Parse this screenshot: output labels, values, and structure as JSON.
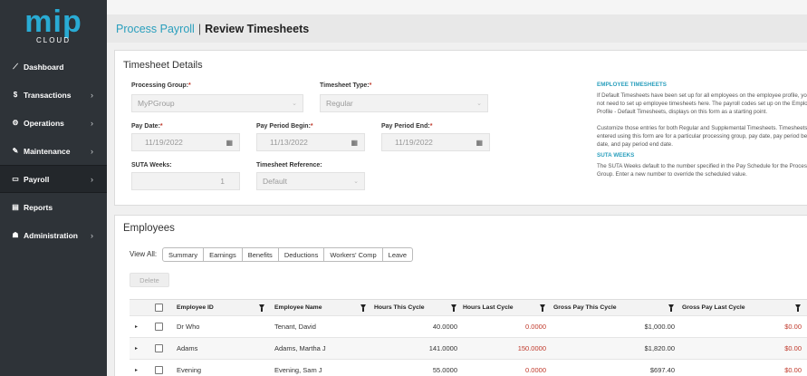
{
  "logo": {
    "brand": "mip",
    "sub": "CLOUD"
  },
  "sidebar": {
    "items": [
      {
        "label": "Dashboard",
        "icon": "chart-icon",
        "glyph": "⟋",
        "chevron": false,
        "active": false
      },
      {
        "label": "Transactions",
        "icon": "dollar-icon",
        "glyph": "$",
        "chevron": true,
        "active": false
      },
      {
        "label": "Operations",
        "icon": "cogs-icon",
        "glyph": "⚙",
        "chevron": true,
        "active": false
      },
      {
        "label": "Maintenance",
        "icon": "wrench-icon",
        "glyph": "✎",
        "chevron": true,
        "active": false
      },
      {
        "label": "Payroll",
        "icon": "money-icon",
        "glyph": "▭",
        "chevron": true,
        "active": true
      },
      {
        "label": "Reports",
        "icon": "file-icon",
        "glyph": "▤",
        "chevron": false,
        "active": false
      },
      {
        "label": "Administration",
        "icon": "users-icon",
        "glyph": "☗",
        "chevron": true,
        "active": false
      }
    ],
    "chevron_glyph": "›"
  },
  "header": {
    "crumb": "Process Payroll",
    "separator": "|",
    "current": "Review Timesheets"
  },
  "details": {
    "title": "Timesheet Details",
    "processing_group": {
      "label": "Processing Group:",
      "required": "*",
      "value": "MyPGroup"
    },
    "timesheet_type": {
      "label": "Timesheet Type:",
      "required": "*",
      "value": "Regular"
    },
    "pay_date": {
      "label": "Pay Date:",
      "required": "*",
      "value": "11/19/2022"
    },
    "period_begin": {
      "label": "Pay Period Begin:",
      "required": "*",
      "value": "11/13/2022"
    },
    "period_end": {
      "label": "Pay Period End:",
      "required": "*",
      "value": "11/19/2022"
    },
    "suta_weeks": {
      "label": "SUTA Weeks:",
      "value": "1"
    },
    "timesheet_ref": {
      "label": "Timesheet Reference:",
      "value": "Default"
    },
    "help": {
      "emp_title": "EMPLOYEE TIMESHEETS",
      "emp_p1": "If Default Timesheets have been set up for all employees on the employee profile, you do not need to set up employee timesheets here. The payroll codes set up on the Employee Profile - Default Timesheets, displays on this form as a starting point.",
      "emp_p2": "Customize those entries for both Regular and Supplemental Timesheets. Timesheets entered using this form are for a particular processing group, pay date, pay period begin date, and pay period end date.",
      "suta_title": "SUTA WEEKS",
      "suta_p": "The SUTA Weeks default to the number specified in the Pay Schedule for the Processing Group. Enter a new number to override the scheduled value."
    }
  },
  "employees": {
    "title": "Employees",
    "view_all_label": "View All:",
    "tabs": [
      "Summary",
      "Earnings",
      "Benefits",
      "Deductions",
      "Workers' Comp",
      "Leave"
    ],
    "delete_label": "Delete",
    "columns": {
      "employee_id": "Employee ID",
      "employee_name": "Employee Name",
      "hours_this": "Hours This Cycle",
      "hours_last": "Hours Last Cycle",
      "gross_this": "Gross Pay This Cycle",
      "gross_last": "Gross Pay Last Cycle"
    },
    "rows": [
      {
        "id": "Dr Who",
        "name": "Tenant, David",
        "hours_this": "40.0000",
        "hours_last": "0.0000",
        "gross_this": "$1,000.00",
        "gross_last": "$0.00"
      },
      {
        "id": "Adams",
        "name": "Adams, Martha J",
        "hours_this": "141.0000",
        "hours_last": "150.0000",
        "gross_this": "$1,820.00",
        "gross_last": "$0.00"
      },
      {
        "id": "Evening",
        "name": "Evening, Sam J",
        "hours_this": "55.0000",
        "hours_last": "0.0000",
        "gross_this": "$697.40",
        "gross_last": "$0.00"
      }
    ]
  },
  "colors": {
    "sidebar_bg": "#2e3338",
    "accent": "#2a9fbd",
    "negative": "#c0392b"
  }
}
